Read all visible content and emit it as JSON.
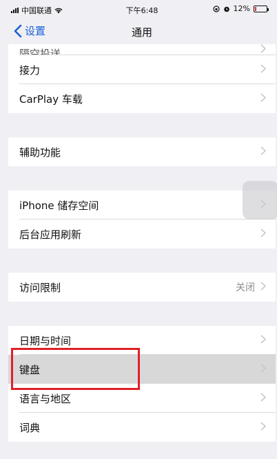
{
  "status": {
    "carrier": "中国联通",
    "time": "下午6:48",
    "battery": "12%",
    "battery_level": 0.12
  },
  "nav": {
    "back_label": "设置",
    "title": "通用"
  },
  "groups": [
    [
      {
        "label": "隔空投送",
        "partial": true
      },
      {
        "label": "接力"
      },
      {
        "label": "CarPlay 车载"
      }
    ],
    [
      {
        "label": "辅助功能"
      }
    ],
    [
      {
        "label": "iPhone 储存空间"
      },
      {
        "label": "后台应用刷新"
      }
    ],
    [
      {
        "label": "访问限制",
        "value": "关闭"
      }
    ],
    [
      {
        "label": "日期与时间"
      },
      {
        "label": "键盘"
      },
      {
        "label": "语言与地区"
      },
      {
        "label": "词典"
      }
    ]
  ],
  "colors": {
    "accent": "#1a5fd6",
    "highlight_border": "#e11f27"
  }
}
